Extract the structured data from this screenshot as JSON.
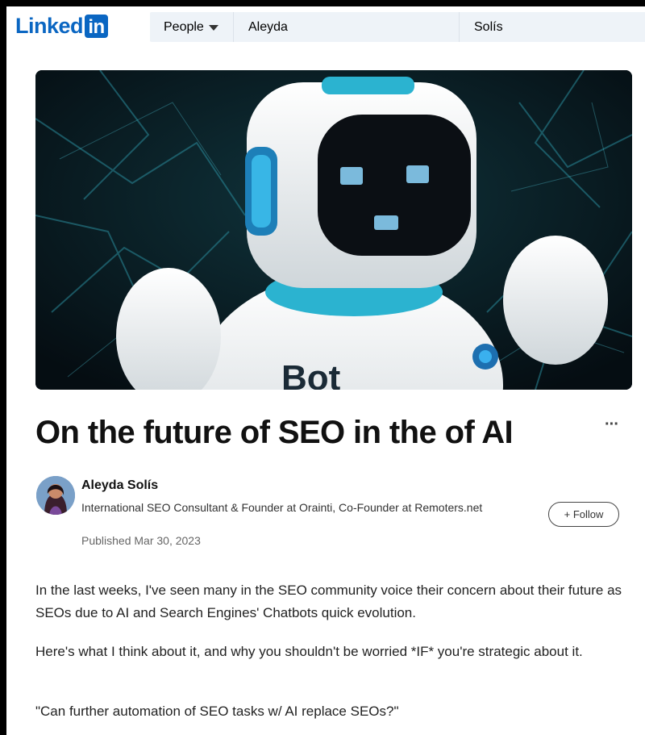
{
  "header": {
    "logo_text": "Linked",
    "logo_in": "in",
    "search": {
      "filter_label": "People",
      "first_name": "Aleyda",
      "last_name": "Solís"
    }
  },
  "hero": {
    "chest_text": "Bot"
  },
  "article": {
    "title": "On the future of SEO in the of AI",
    "more_label": "···",
    "author": {
      "name": "Aleyda Solís",
      "headline": "International SEO Consultant & Founder at Orainti, Co-Founder at Remoters.net",
      "published": "Published Mar 30, 2023",
      "follow_label": "+ Follow"
    },
    "paragraphs": [
      "In the last weeks, I've seen many in the SEO community voice their concern about their future as SEOs due to AI and Search Engines' Chatbots quick evolution.",
      "Here's what I think about it, and why you shouldn't be worried *IF* you're strategic about it.",
      "\"Can further automation of SEO tasks w/ AI replace SEOs?\""
    ]
  },
  "colors": {
    "brand": "#0a66c2",
    "frame": "#000000",
    "search_bg": "#eef3f8"
  }
}
